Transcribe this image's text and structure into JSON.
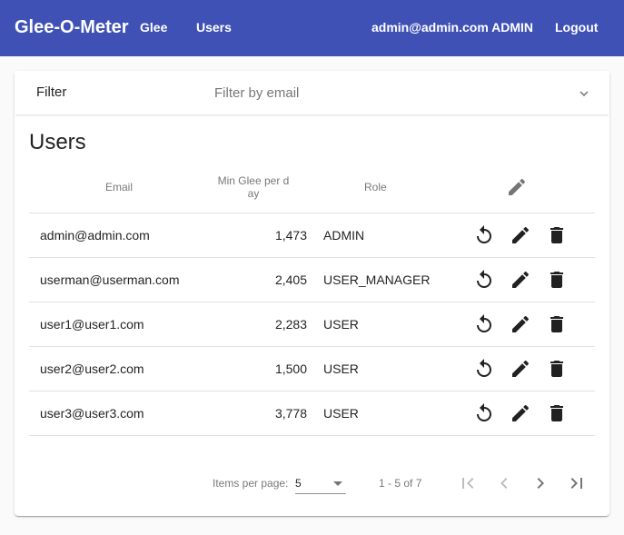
{
  "app": {
    "title": "Glee-O-Meter",
    "nav": [
      "Glee",
      "Users"
    ],
    "user_label": "admin@admin.com ADMIN",
    "logout_label": "Logout",
    "accent_color": "#3f51b5"
  },
  "filter": {
    "title": "Filter",
    "placeholder": "Filter by email",
    "expand_icon": "chevron-down-icon"
  },
  "users": {
    "title": "Users",
    "columns": {
      "email": "Email",
      "min_glee_line1": "Min Glee per d",
      "min_glee_line2": "ay",
      "role": "Role",
      "actions_icon": "edit-icon"
    },
    "rows": [
      {
        "email": "admin@admin.com",
        "min_glee": "1,473",
        "role": "ADMIN"
      },
      {
        "email": "userman@userman.com",
        "min_glee": "2,405",
        "role": "USER_MANAGER"
      },
      {
        "email": "user1@user1.com",
        "min_glee": "2,283",
        "role": "USER"
      },
      {
        "email": "user2@user2.com",
        "min_glee": "1,500",
        "role": "USER"
      },
      {
        "email": "user3@user3.com",
        "min_glee": "3,778",
        "role": "USER"
      }
    ],
    "row_action_icons": [
      "reset-icon",
      "edit-icon",
      "delete-icon"
    ]
  },
  "paginator": {
    "items_per_page_label": "Items per page:",
    "page_size": "5",
    "range_label": "1 - 5 of 7",
    "icons": [
      "first-page-icon",
      "previous-page-icon",
      "next-page-icon",
      "last-page-icon"
    ]
  }
}
